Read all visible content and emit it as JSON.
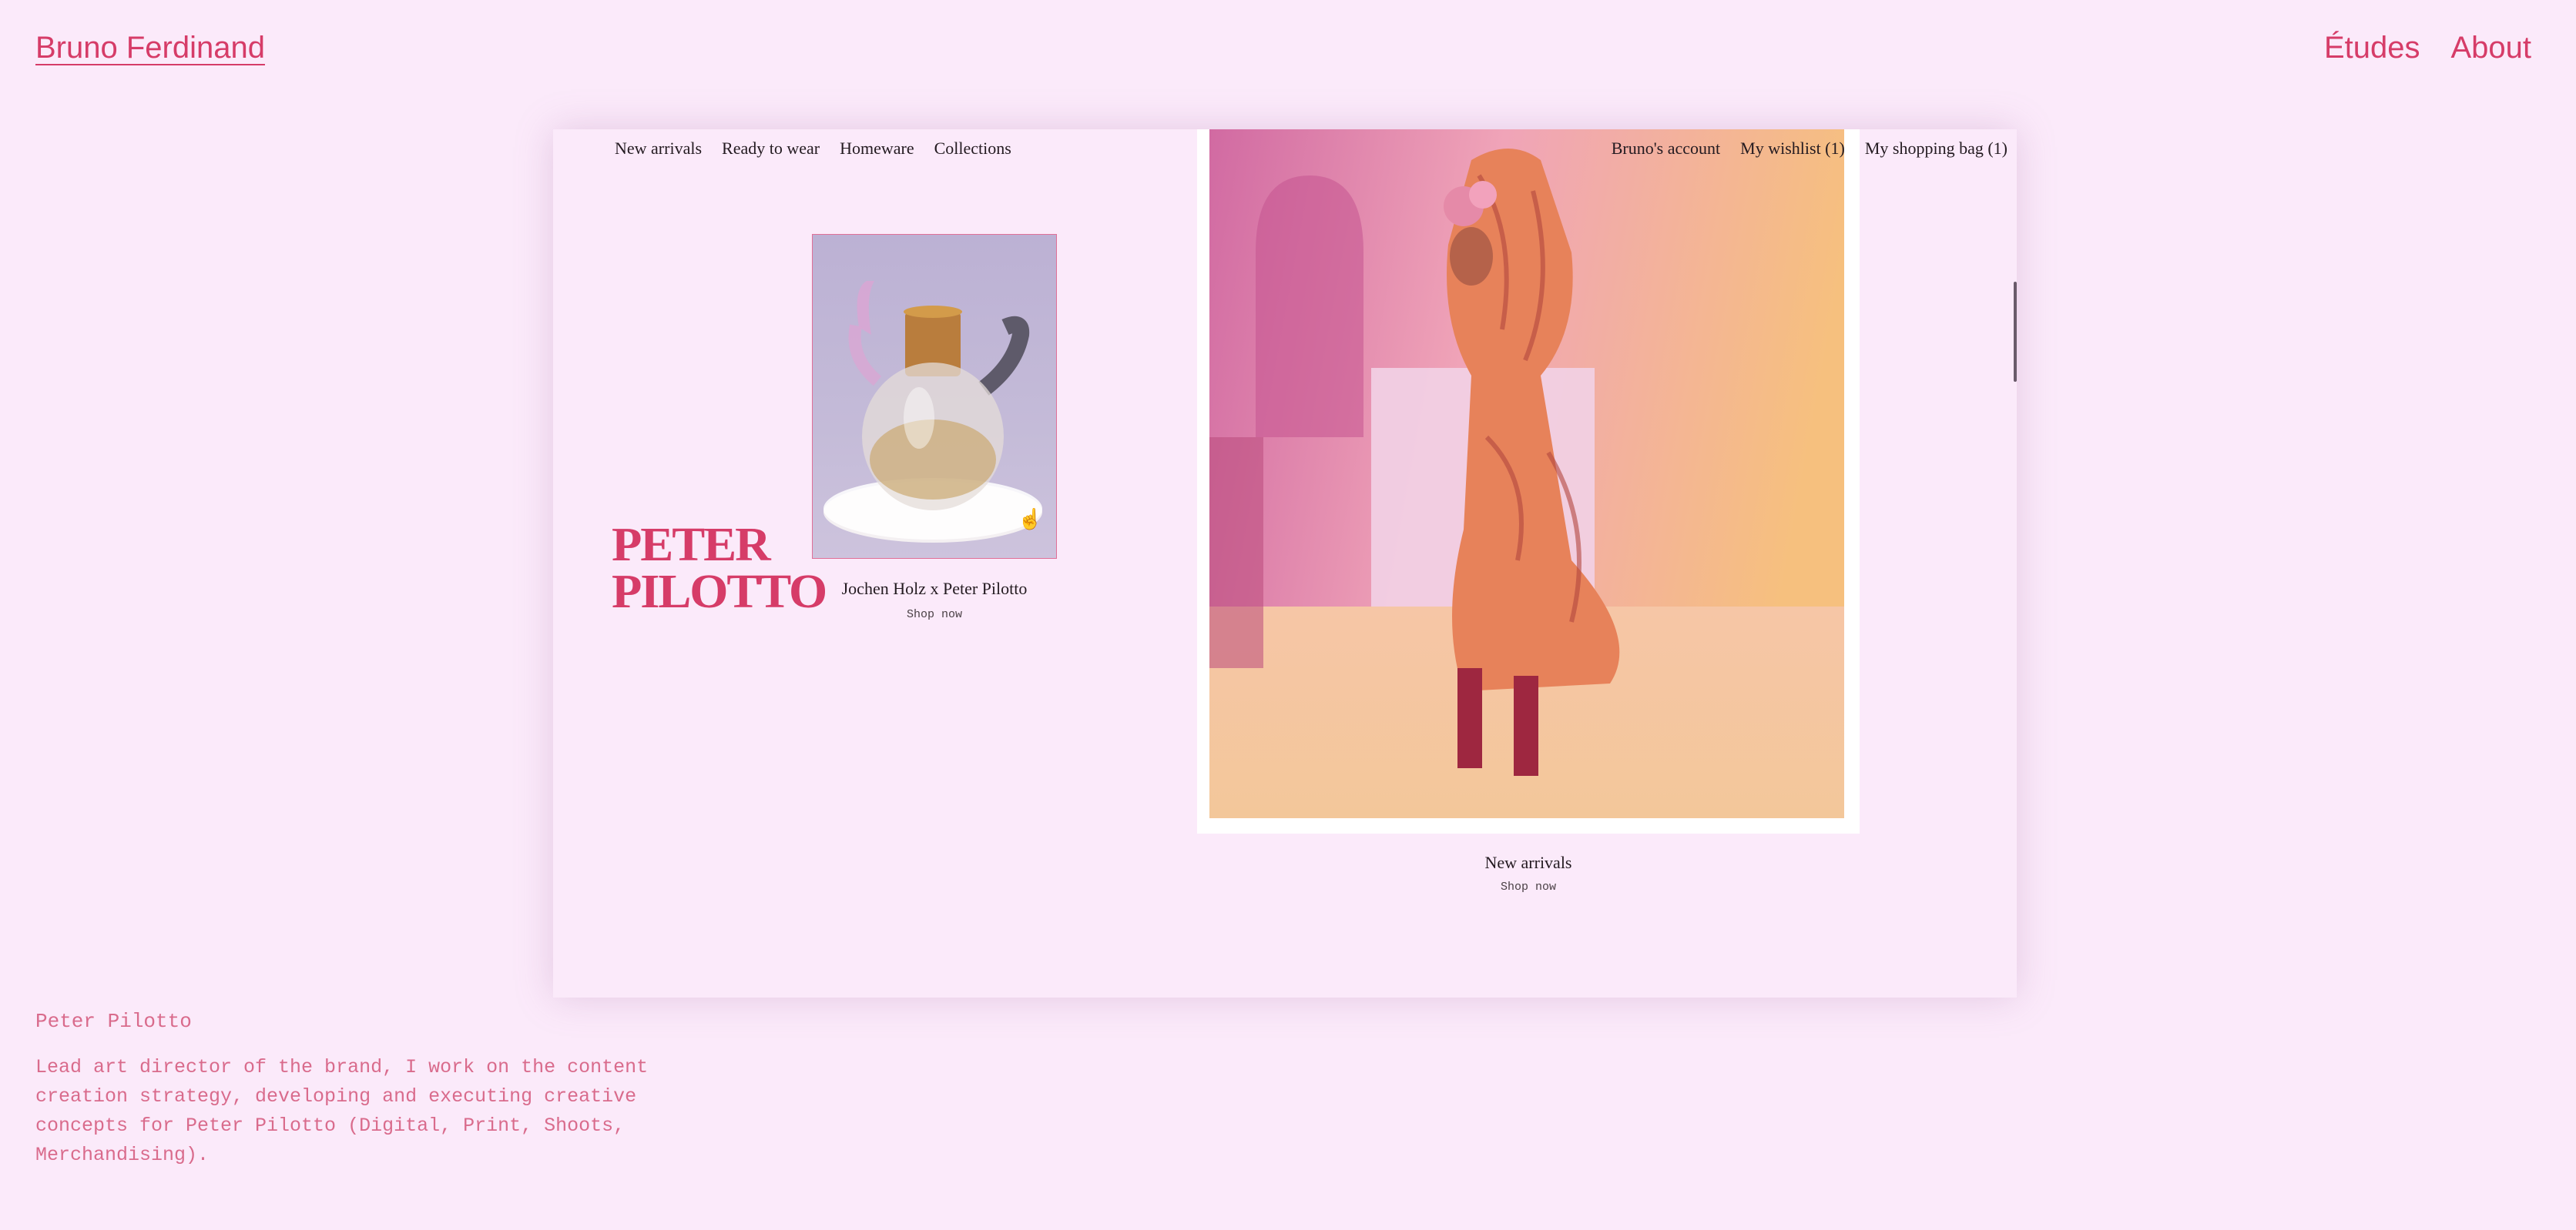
{
  "site": {
    "title": "Bruno Ferdinand",
    "nav": [
      "Études",
      "About"
    ]
  },
  "shop": {
    "nav_left": [
      "New arrivals",
      "Ready to wear",
      "Homeware",
      "Collections"
    ],
    "nav_right": [
      "Bruno's account",
      "My wishlist (1)",
      "My shopping bag (1)"
    ],
    "logo_lines": [
      "PETER",
      "PILOTTO"
    ],
    "product": {
      "name": "Jochen Holz x Peter Pilotto",
      "cta": "Shop now"
    },
    "hero": {
      "caption": "New arrivals",
      "cta": "Shop now"
    }
  },
  "project": {
    "title": "Peter Pilotto",
    "description": "Lead art director of the brand, I work on the content creation strategy, developing and executing creative concepts for Peter Pilotto (Digital, Print, Shoots, Merchandising)."
  },
  "colors": {
    "background": "#fbeafa",
    "accent": "#d63c68",
    "text_muted": "#d96b8c"
  },
  "icons": [
    "hand-pointer-icon"
  ]
}
